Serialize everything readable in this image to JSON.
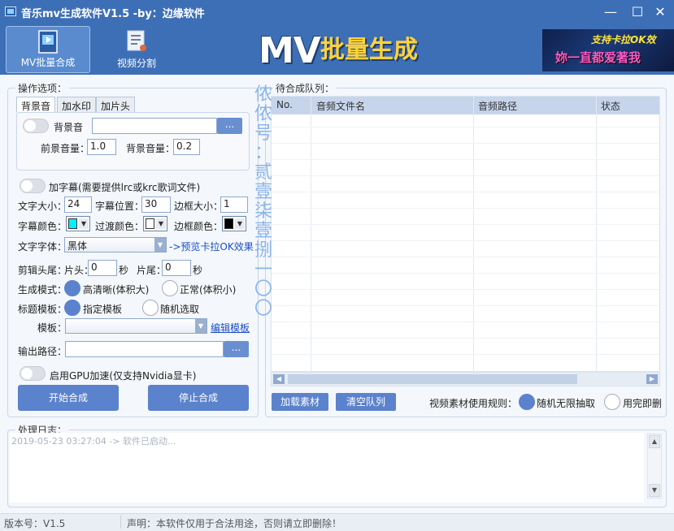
{
  "window": {
    "title": "音乐mv生成软件V1.5 -by：边缘软件",
    "minimize": "—",
    "maximize": "☐",
    "close": "✕"
  },
  "toolbar": {
    "batch_label": "MV批量合成",
    "split_label": "视频分割"
  },
  "banner": {
    "mv": "MV",
    "cn": "批量生成",
    "img_line1": "支持卡拉OK效",
    "img_line2": "妳一直都爱著我"
  },
  "options": {
    "group_title": "操作选项：",
    "tabs": [
      "背景音",
      "加水印",
      "加片头"
    ],
    "bgm_label": "背景音",
    "bgm_path": "",
    "browse": "...",
    "fg_volume_label": "前景音量：",
    "fg_volume": "1.0",
    "bg_volume_label": "背景音量：",
    "bg_volume": "0.2",
    "subtitle_label": "加字幕(需要提供lrc或krc歌词文件)",
    "font_size_label": "文字大小：",
    "font_size": "24",
    "sub_pos_label": "字幕位置：",
    "sub_pos": "30",
    "border_size_label": "边框大小：",
    "border_size": "1",
    "font_color_label": "字幕颜色：",
    "font_color": "#00f0ff",
    "transition_color_label": "过渡颜色：",
    "transition_color": "#ffffff",
    "border_color_label": "边框颜色：",
    "border_color": "#000000",
    "font_family_label": "文字字体：",
    "font_family": "黑体",
    "preview_link": "->预览卡拉OK效果",
    "trim_label": "剪辑头尾：",
    "head_label": "片头：",
    "head_value": "0",
    "head_unit": "秒",
    "tail_label": "片尾：",
    "tail_value": "0",
    "tail_unit": "秒",
    "mode_label": "生成模式：",
    "mode_hd": "高清晰(体积大)",
    "mode_normal": "正常(体积小)",
    "title_tpl_label": "标题模板：",
    "tpl_fixed": "指定模板",
    "tpl_random": "随机选取",
    "template_label": "模板：",
    "template_value": "",
    "edit_template": "编辑模板",
    "output_label": "输出路径：",
    "output_path": "",
    "gpu_label": "启用GPU加速(仅支持Nvidia显卡)",
    "start": "开始合成",
    "stop": "停止合成"
  },
  "watermark": [
    "侬",
    "侬",
    "号",
    "：",
    "贰",
    "壹",
    "柒",
    "壹",
    "捌",
    "一",
    "〇",
    "〇"
  ],
  "queue": {
    "group_title": "待合成队列：",
    "columns": [
      "No.",
      "音频文件名",
      "音频路径",
      "状态"
    ],
    "add_material": "加载素材",
    "clear_queue": "清空队列",
    "rule_label": "视频素材使用规则：",
    "rule_random": "随机无限抽取",
    "rule_once": "用完即删"
  },
  "log": {
    "group_title": "处理日志：",
    "lines": [
      "2019-05-23 03:27:04 -> 软件已启动..."
    ]
  },
  "status": {
    "version": "版本号：V1.5",
    "notice": "声明：本软件仅用于合法用途，否则请立即删除！"
  }
}
